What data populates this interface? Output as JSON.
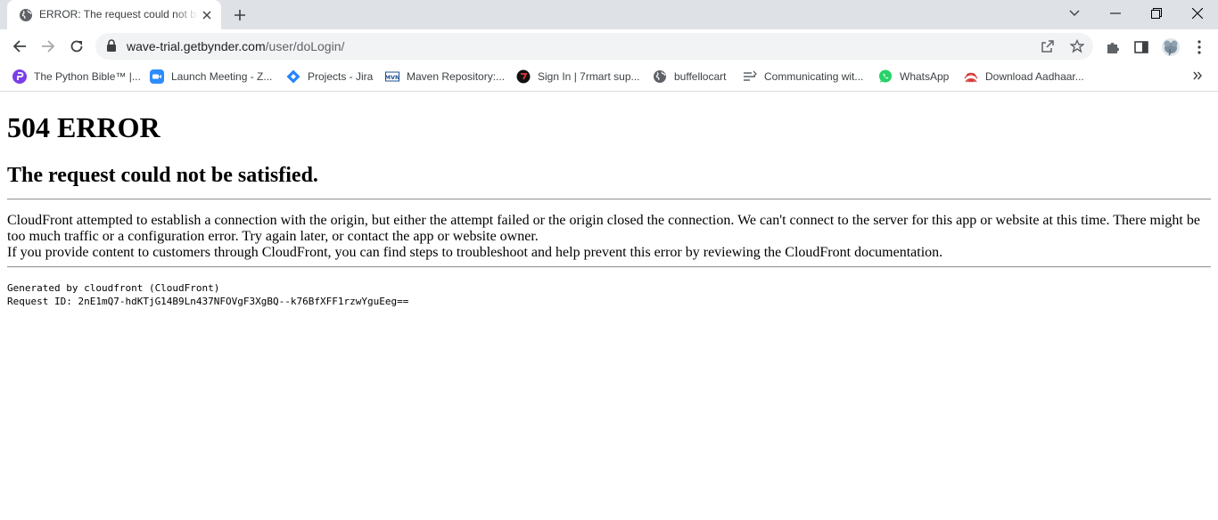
{
  "browser": {
    "tab": {
      "title": "ERROR: The request could not be satisfied",
      "favicon": "globe-icon"
    },
    "url": {
      "domain": "wave-trial.getbynder.com",
      "path": "/user/doLogin/"
    },
    "bookmarks": [
      {
        "label": "The Python Bible™ |...",
        "icon": "python-bible-icon",
        "color": "#7b3fe4"
      },
      {
        "label": "Launch Meeting - Z...",
        "icon": "zoom-icon",
        "color": "#2d8cff"
      },
      {
        "label": "Projects - Jira",
        "icon": "jira-icon",
        "color": "#2684ff"
      },
      {
        "label": "Maven Repository:...",
        "icon": "maven-icon",
        "color": "#1d4f91"
      },
      {
        "label": "Sign In | 7rmart sup...",
        "icon": "7rmart-icon",
        "color": "#111111"
      },
      {
        "label": "buffellocart",
        "icon": "globe-icon",
        "color": "#5f6368"
      },
      {
        "label": "Communicating wit...",
        "icon": "communicating-icon",
        "color": "#5f6368"
      },
      {
        "label": "WhatsApp",
        "icon": "whatsapp-icon",
        "color": "#25d366"
      },
      {
        "label": "Download Aadhaar...",
        "icon": "aadhaar-icon",
        "color": "#d32f2f"
      }
    ]
  },
  "page": {
    "heading": "504 ERROR",
    "subheading": "The request could not be satisfied.",
    "paragraph_line1": "CloudFront attempted to establish a connection with the origin, but either the attempt failed or the origin closed the connection. We can't connect to the server for this app or website at this time. There might be too much traffic or a configuration error. Try again later, or contact the app or website owner.",
    "paragraph_line2": "If you provide content to customers through CloudFront, you can find steps to troubleshoot and help prevent this error by reviewing the CloudFront documentation.",
    "generated_by": "Generated by cloudfront (CloudFront)",
    "request_id": "Request ID: 2nE1mQ7-hdKTjG14B9Ln437NFOVgF3XgBQ--k76BfXFF1rzwYguEeg=="
  }
}
